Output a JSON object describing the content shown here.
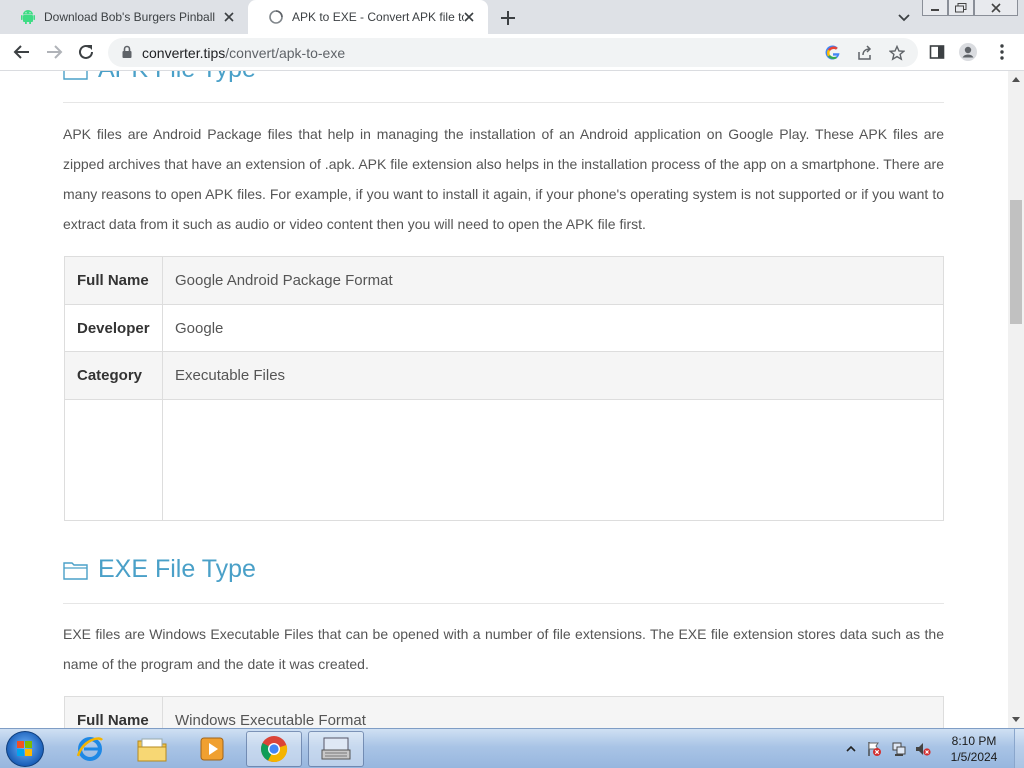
{
  "browser": {
    "tabs": [
      {
        "title": "Download Bob's Burgers Pinball",
        "active": false,
        "icon": "android-icon"
      },
      {
        "title": "APK to EXE - Convert APK file to",
        "active": true,
        "icon": "loading-globe-icon"
      }
    ],
    "url": {
      "host": "converter.tips",
      "path": "/convert/apk-to-exe"
    }
  },
  "apk_section": {
    "title": "APK File Type",
    "paragraph": "APK files are Android Package files that help in managing the installation of an Android application on Google Play. These APK files are zipped archives that have an extension of .apk. APK file extension also helps in the installation process of the app on a smartphone. There are many reasons to open APK files. For example, if you want to install it again, if your phone's operating system is not supported or if you want to extract data from it such as audio or video content then you will need to open the APK file first.",
    "table": [
      {
        "key": "Full Name",
        "value": "Google Android Package Format"
      },
      {
        "key": "Developer",
        "value": "Google"
      },
      {
        "key": "Category",
        "value": "Executable Files"
      },
      {
        "key": "",
        "value": ""
      }
    ]
  },
  "exe_section": {
    "title": "EXE File Type",
    "paragraph": "EXE files are Windows Executable Files that can be opened with a number of file extensions. The EXE file extension stores data such as the name of the program and the date it was created.",
    "table": [
      {
        "key": "Full Name",
        "value": "Windows Executable Format"
      }
    ]
  },
  "taskbar": {
    "time": "8:10 PM",
    "date": "1/5/2024"
  },
  "colors": {
    "heading": "#4aa0c8",
    "tab_strip": "#dee1e6",
    "taskbar": "#a9c4e6"
  }
}
